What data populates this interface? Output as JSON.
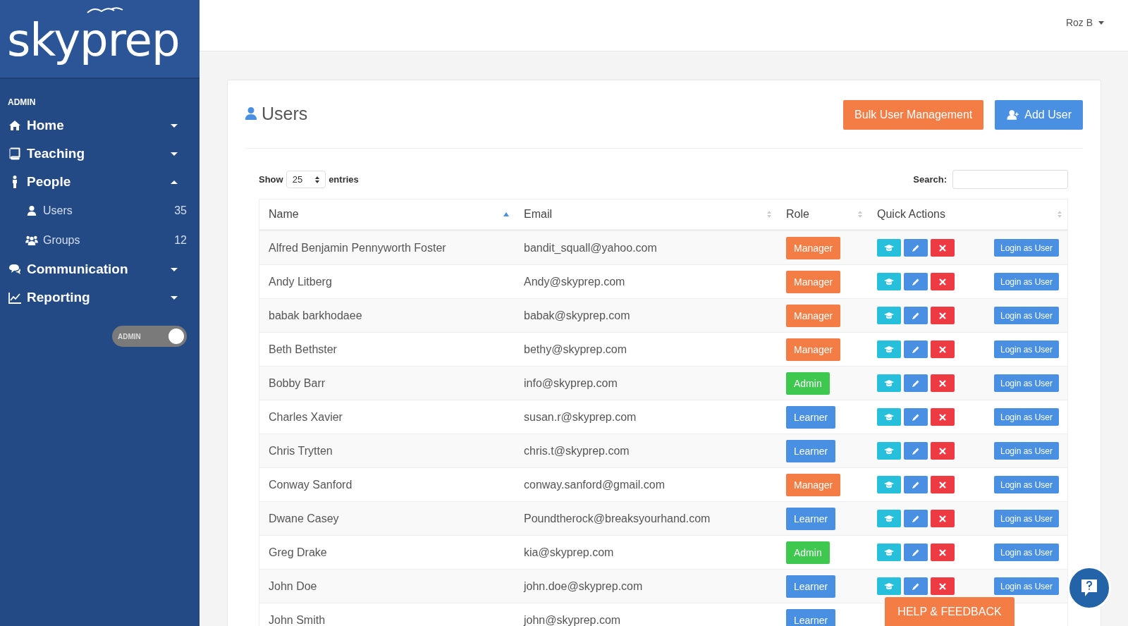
{
  "sidebar": {
    "logo": "skyprep",
    "section": "ADMIN",
    "items": [
      {
        "label": "Home",
        "expanded": false
      },
      {
        "label": "Teaching",
        "expanded": false
      },
      {
        "label": "People",
        "expanded": true,
        "children": [
          {
            "label": "Users",
            "count": "35"
          },
          {
            "label": "Groups",
            "count": "12"
          }
        ]
      },
      {
        "label": "Communication",
        "expanded": false
      },
      {
        "label": "Reporting",
        "expanded": false
      }
    ],
    "toggle": {
      "label": "ADMIN",
      "on": true
    }
  },
  "topbar": {
    "user": "Roz B"
  },
  "page": {
    "title": "Users",
    "buttons": [
      {
        "label": "Bulk User Management",
        "kind": "orange"
      },
      {
        "label": "Add User",
        "kind": "blue"
      }
    ]
  },
  "table": {
    "length_label_before": "Show",
    "length_value": "25",
    "length_label_after": "entries",
    "search_label": "Search:",
    "columns": [
      {
        "label": "Name",
        "sorted": true
      },
      {
        "label": "Email",
        "sorted": false
      },
      {
        "label": "Role",
        "sorted": false
      },
      {
        "label": "Quick Actions",
        "sorted": false
      }
    ],
    "rows": [
      {
        "name": "Alfred Benjamin Pennyworth Foster",
        "email": "bandit_squall@yahoo.com",
        "role": {
          "label": "Manager",
          "kind": "manager"
        },
        "login": "Login as User"
      },
      {
        "name": "Andy Litberg",
        "email": "Andy@skyprep.com",
        "role": {
          "label": "Manager",
          "kind": "manager"
        },
        "login": "Login as User"
      },
      {
        "name": "babak barkhodaee",
        "email": "babak@skyprep.com",
        "role": {
          "label": "Manager",
          "kind": "manager"
        },
        "login": "Login as User"
      },
      {
        "name": "Beth Bethster",
        "email": "bethy@skyprep.com",
        "role": {
          "label": "Manager",
          "kind": "manager"
        },
        "login": "Login as User"
      },
      {
        "name": "Bobby Barr",
        "email": "info@skyprep.com",
        "role": {
          "label": "Admin",
          "kind": "admin"
        },
        "login": "Login as User"
      },
      {
        "name": "Charles Xavier",
        "email": "susan.r@skyprep.com",
        "role": {
          "label": "Learner",
          "kind": "learner"
        },
        "login": "Login as User"
      },
      {
        "name": "Chris Trytten",
        "email": "chris.t@skyprep.com",
        "role": {
          "label": "Learner",
          "kind": "learner"
        },
        "login": "Login as User"
      },
      {
        "name": "Conway Sanford",
        "email": "conway.sanford@gmail.com",
        "role": {
          "label": "Manager",
          "kind": "manager"
        },
        "login": "Login as User"
      },
      {
        "name": "Dwane Casey",
        "email": "Poundtherock@breaksyourhand.com",
        "role": {
          "label": "Learner",
          "kind": "learner"
        },
        "login": "Login as User"
      },
      {
        "name": "Greg Drake",
        "email": "kia@skyprep.com",
        "role": {
          "label": "Admin",
          "kind": "admin"
        },
        "login": "Login as User"
      },
      {
        "name": "John Doe",
        "email": "john.doe@skyprep.com",
        "role": {
          "label": "Learner",
          "kind": "learner"
        },
        "login": "Login as User"
      },
      {
        "name": "John Smith",
        "email": "john@skyprep.com",
        "role": {
          "label": "Learner",
          "kind": "learner"
        }
      }
    ]
  },
  "help_tab": "HELP & FEEDBACK"
}
